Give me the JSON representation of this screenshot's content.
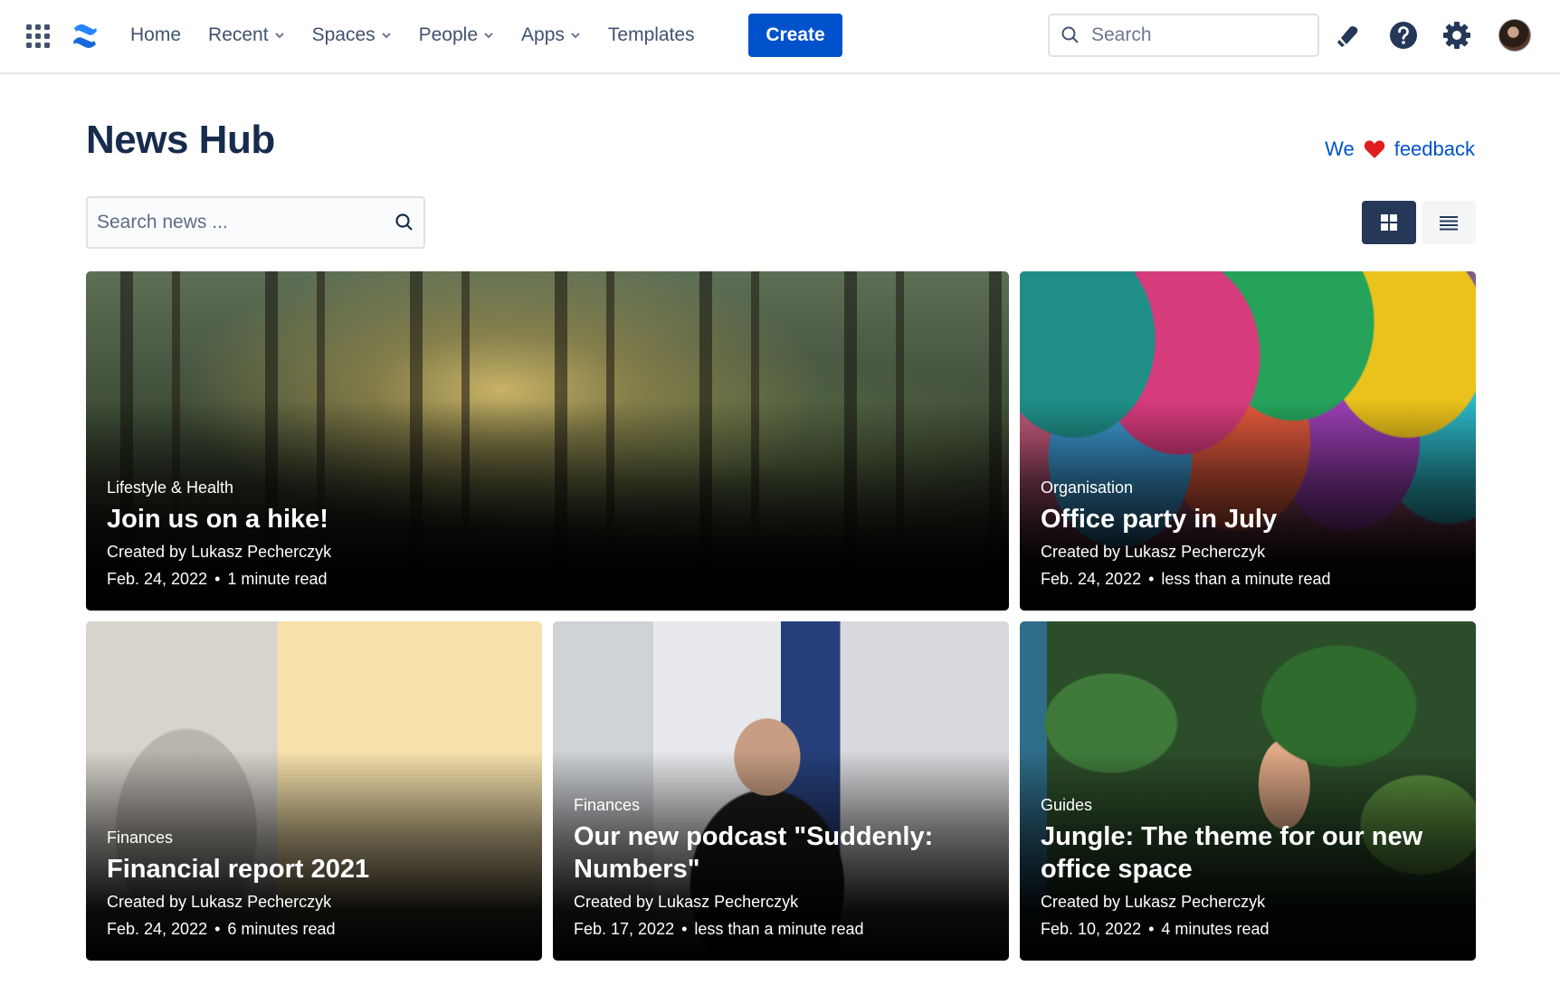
{
  "topbar": {
    "nav": [
      {
        "label": "Home",
        "dropdown": false
      },
      {
        "label": "Recent",
        "dropdown": true
      },
      {
        "label": "Spaces",
        "dropdown": true
      },
      {
        "label": "People",
        "dropdown": true
      },
      {
        "label": "Apps",
        "dropdown": true
      },
      {
        "label": "Templates",
        "dropdown": false
      }
    ],
    "create_label": "Create",
    "search_placeholder": "Search",
    "icons": [
      "app-switcher-icon",
      "confluence-logo-icon",
      "notification-icon",
      "help-icon",
      "settings-icon"
    ]
  },
  "page": {
    "title": "News Hub",
    "feedback_prefix": "We",
    "feedback_label": "feedback",
    "news_search_placeholder": "Search news ...",
    "view_mode": "grid"
  },
  "colors": {
    "primary": "#0052CC",
    "title": "#172B4D",
    "view_active": "#253858"
  },
  "articles": [
    {
      "category": "Lifestyle & Health",
      "title": "Join us on a hike!",
      "author": "Created by Lukasz Pecherczyk",
      "date": "Feb. 24, 2022",
      "read_time": "1 minute read"
    },
    {
      "category": "Organisation",
      "title": "Office party in July",
      "author": "Created by Lukasz Pecherczyk",
      "date": "Feb. 24, 2022",
      "read_time": "less than a minute read"
    },
    {
      "category": "Finances",
      "title": "Financial report 2021",
      "author": "Created by Lukasz Pecherczyk",
      "date": "Feb. 24, 2022",
      "read_time": "6 minutes read"
    },
    {
      "category": "Finances",
      "title": "Our new podcast \"Suddenly: Numbers\"",
      "author": "Created by Lukasz Pecherczyk",
      "date": "Feb. 17, 2022",
      "read_time": "less than a minute read"
    },
    {
      "category": "Guides",
      "title": "Jungle: The theme for our new office space",
      "author": "Created by Lukasz Pecherczyk",
      "date": "Feb. 10, 2022",
      "read_time": "4 minutes read"
    }
  ]
}
